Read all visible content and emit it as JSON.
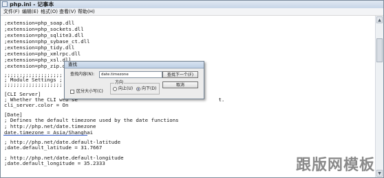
{
  "window": {
    "title": "php.ini - 记事本",
    "app_icon": "notepad-icon"
  },
  "menu": {
    "items": [
      "文件(F)",
      "编辑(E)",
      "格式(O)",
      "查看(V)",
      "帮助(H)"
    ]
  },
  "editor": {
    "lines": [
      ";extension=php_soap.dll",
      ";extension=php_sockets.dll",
      ";extension=php_sqlite3.dll",
      ";extension=php_sybase_ct.dll",
      ";extension=php_tidy.dll",
      ";extension=php_xmlrpc.dll",
      ";extension=php_xsl.dll",
      ";extension=php_zip.dll",
      "",
      ";;;;;;;;;;;;;;;;;;;",
      "; Module Settings ;",
      ";;;;;;;;;;;;;;;;;;;",
      "",
      "[CLI Server]",
      "; Whether the CLI web se                                              t.",
      "cli_server.color = On",
      "",
      "[Date]",
      "; Defines the default timezone used by the date functions",
      "; http://php.net/date.timezone",
      "date.timezone = Asia/Shanghai",
      "",
      "; http://php.net/date.default-latitude",
      ";date.default_latitude = 31.7667",
      "",
      "; http://php.net/date.default-longitude",
      ";date.default_longitude = 35.2333"
    ]
  },
  "find_dialog": {
    "title": "查找",
    "find_label": "查找内容(N):",
    "find_value": "date.timezone",
    "find_next_button": "查找下一个(F)",
    "cancel_button": "取消",
    "direction_label": "方向",
    "up_label": "向上(U)",
    "down_label": "向下(D)",
    "match_case_label": "区分大小写(C)",
    "direction_selected": "down",
    "match_case_checked": false
  },
  "scrollbar": {
    "up_icon": "arrow-up-icon",
    "down_icon": "arrow-down-icon"
  },
  "watermark": {
    "text": "跟版网模板"
  }
}
